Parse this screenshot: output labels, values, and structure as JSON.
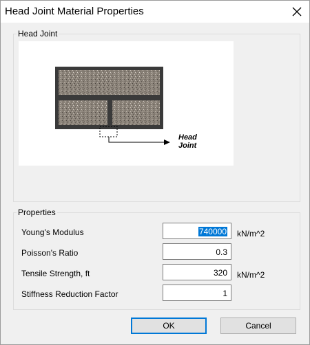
{
  "window": {
    "title": "Head Joint Material Properties",
    "close_icon": "close-icon"
  },
  "head_joint_group": {
    "label": "Head Joint",
    "diagram": {
      "annotation": "Head Joint",
      "colors": {
        "mortar": "#3a3a3a",
        "brick_texture": "#8a8278",
        "line": "#000000"
      }
    }
  },
  "properties_group": {
    "label": "Properties",
    "fields": [
      {
        "label": "Young's Modulus",
        "value": "740000",
        "unit": "kN/m^2",
        "selected": true
      },
      {
        "label": "Poisson's Ratio",
        "value": "0.3",
        "unit": ""
      },
      {
        "label": "Tensile Strength, ft",
        "value": "320",
        "unit": "kN/m^2"
      },
      {
        "label": "Stiffness Reduction Factor",
        "value": "1",
        "unit": ""
      }
    ]
  },
  "buttons": {
    "ok": "OK",
    "cancel": "Cancel"
  },
  "colors": {
    "accent": "#0078d7",
    "background": "#f0f0f0"
  }
}
